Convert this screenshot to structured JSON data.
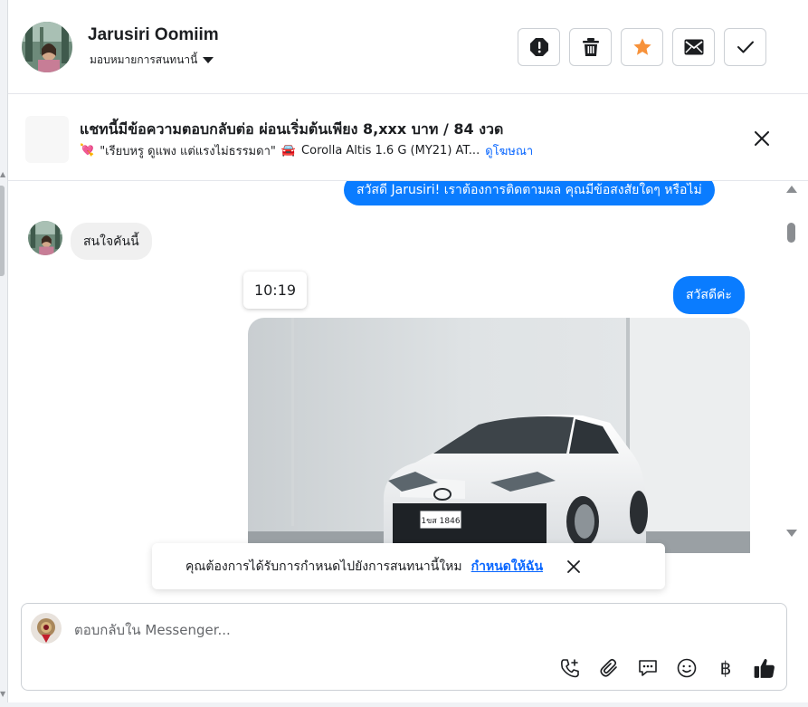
{
  "contact": {
    "name": "Jarusiri Oomiim",
    "assign_label": "มอบหมายการสนทนานี้"
  },
  "header_actions": [
    {
      "name": "report-button",
      "icon": "alert-icon"
    },
    {
      "name": "delete-button",
      "icon": "trash-icon"
    },
    {
      "name": "star-button",
      "icon": "star-icon",
      "color": "#f7923b"
    },
    {
      "name": "mail-button",
      "icon": "envelope-icon"
    },
    {
      "name": "done-button",
      "icon": "check-icon"
    }
  ],
  "ad_banner": {
    "title": "แชทนี้มีข้อความตอบกลับต่อ ผ่อนเริ่มต้นเพียง 8,xxx บาท / 84 งวด",
    "heart_emoji": "💘",
    "tagline": "\"เรียบหรู ดูแพง แต่แรงไม่ธรรมดา\"",
    "car_emoji": "🚘",
    "model": "Corolla Altis 1.6 G (MY21) AT...",
    "view_ad_link": "ดูโฆษณา"
  },
  "messages": {
    "outgoing_1": "สวัสดี Jarusiri! เราต้องการติดตามผล คุณมีข้อสงสัยใดๆ หรือไม่",
    "incoming_1": "สนใจคันนี้",
    "timestamp": "10:19",
    "outgoing_2": "สวัสดีค่ะ",
    "plate": "1ขส 1846"
  },
  "assign_toast": {
    "text": "คุณต้องการได้รับการกำหนดไปยังการสนทนานี้ใหม",
    "link": "กำหนดให้ฉัน"
  },
  "composer": {
    "placeholder": "ตอบกลับใน Messenger...",
    "baht_symbol": "฿"
  },
  "colors": {
    "accent_blue": "#0a7cff",
    "link_blue": "#0866ff",
    "star_orange": "#f7923b"
  }
}
